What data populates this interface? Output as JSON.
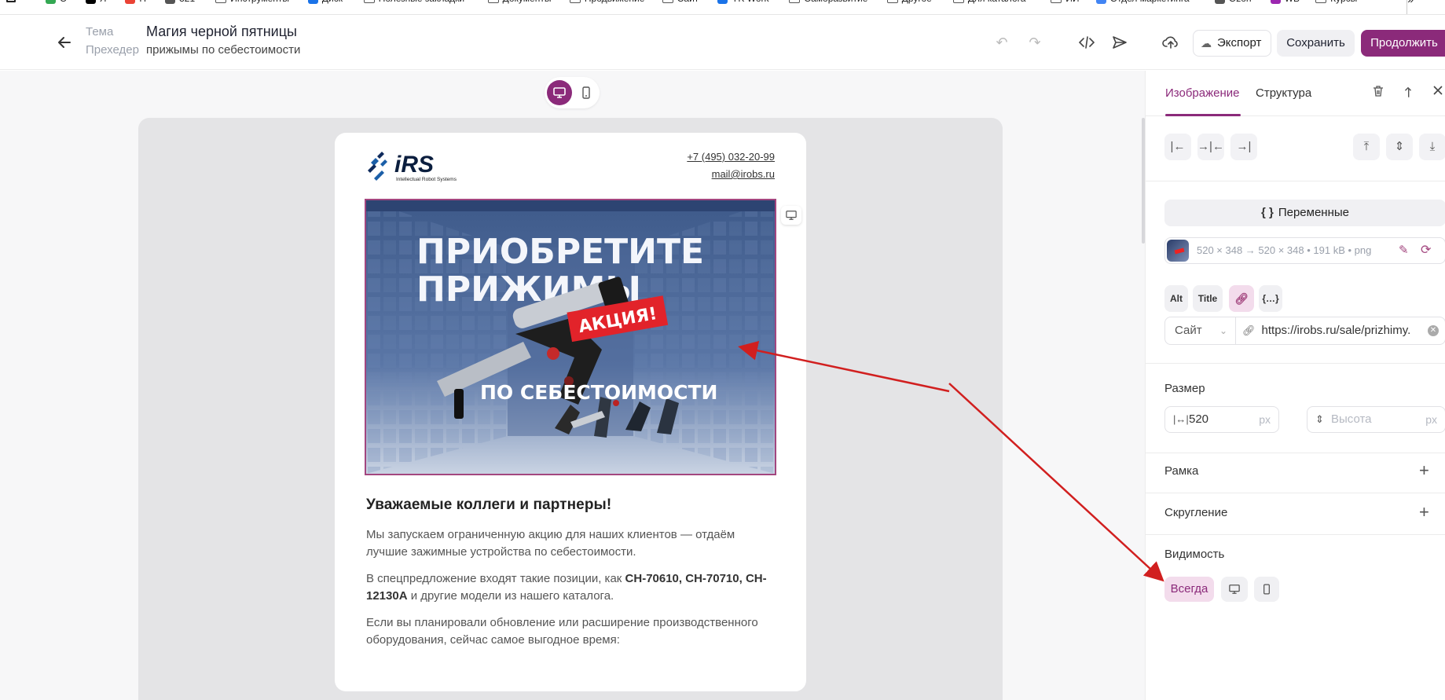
{
  "bookmarks": [
    {
      "label": "С",
      "color": "#34a853"
    },
    {
      "label": "Я",
      "color": "#000000"
    },
    {
      "label": "Н",
      "color": "#ea4335"
    },
    {
      "label": "321",
      "color": "#555555"
    },
    {
      "label": "Инструменты",
      "folder": true
    },
    {
      "label": "Диск",
      "color": "#1a73e8"
    },
    {
      "label": "Полезные закладки",
      "folder": true
    },
    {
      "label": "Документы",
      "folder": true
    },
    {
      "label": "Продвижение",
      "folder": true
    },
    {
      "label": "Сайт",
      "folder": true
    },
    {
      "label": "YK Work",
      "color": "#1a73e8"
    },
    {
      "label": "Саморазвитие",
      "folder": true
    },
    {
      "label": "Другое",
      "folder": true
    },
    {
      "label": "Для каталога",
      "folder": true
    },
    {
      "label": "ИИ",
      "folder": true
    },
    {
      "label": "Отдел маркетинга",
      "color": "#4285f4"
    },
    {
      "label": "Ozon",
      "color": "#555555"
    },
    {
      "label": "WB",
      "color": "#9c27b0"
    },
    {
      "label": "Курсы",
      "folder": true
    }
  ],
  "bookmarks_more": "»",
  "header": {
    "back_icon": "arrow-left-icon",
    "theme_label": "Тема",
    "preheader_label": "Прехедер",
    "title": "Магия черной пятницы",
    "subtitle": "прижымы по себестоимости",
    "export_label": "Экспорт",
    "save_label": "Сохранить",
    "continue_label": "Продолжить"
  },
  "canvas": {
    "device_modes": [
      "desktop-icon",
      "mobile-icon"
    ],
    "active_device": "desktop"
  },
  "email": {
    "logo_text": "iRS",
    "logo_tagline": "Intellectual Robot Systems",
    "phone": "+7 (495) 032-20-99",
    "email": "mail@irobs.ru",
    "hero": {
      "line1": "ПРИОБРЕТИТЕ",
      "line2": "ПРИЖИМЫ",
      "badge": "АКЦИЯ!",
      "bottom": "ПО СЕБЕСТОИМОСТИ"
    },
    "heading": "Уважаемые коллеги и партнеры!",
    "p1": "Мы запускаем ограниченную акцию для наших клиентов — отдаём лучшие зажимные устройства по себестоимости.",
    "p2_before": "В спецпредложение входят такие позиции, как ",
    "p2_bold": "CH-70610, CH-70710, CH-12130A",
    "p2_after": " и другие модели из нашего каталога.",
    "p3": "Если вы планировали обновление или расширение производственного оборудования, сейчас самое выгодное время:"
  },
  "panel": {
    "tab_image": "Изображение",
    "tab_structure": "Структура",
    "variables_label": "Переменные",
    "image_meta": "520 × 348 → 520 × 348 • 191 kB • png",
    "alt_label": "Alt",
    "title_label": "Title",
    "link_type": "Сайт",
    "link_url": "https://irobs.ru/sale/prizhimy.",
    "size_label": "Размер",
    "width_value": "520",
    "width_unit": "px",
    "height_placeholder": "Высота",
    "height_unit": "px",
    "border_label": "Рамка",
    "rounding_label": "Скругление",
    "visibility_label": "Видимость",
    "visibility_always": "Всегда"
  },
  "colors": {
    "accent": "#8b2a7a",
    "accent_soft": "#f3dcec",
    "annotation_arrow": "#d11f1f"
  }
}
